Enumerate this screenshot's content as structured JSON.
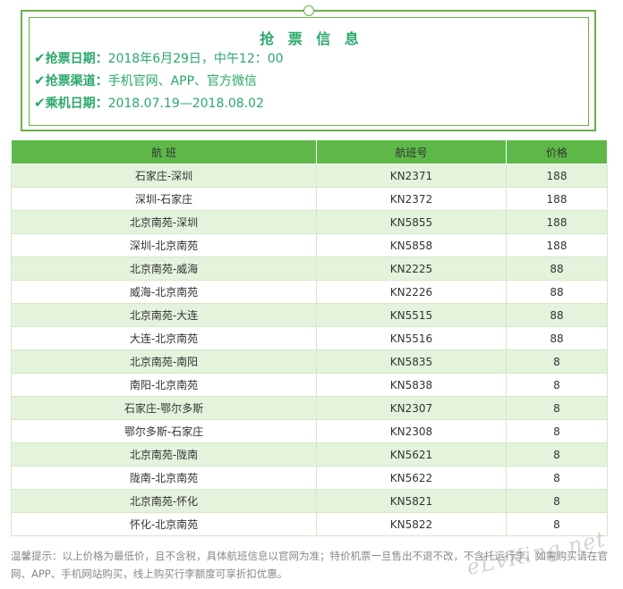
{
  "info": {
    "title": "抢 票 信 息",
    "check_glyph": "✔",
    "lines": [
      {
        "label": "抢票日期：",
        "value": "2018年6月29日，中午12：00"
      },
      {
        "label": "抢票渠道：",
        "value": "手机官网、APP、官方微信"
      },
      {
        "label": "乘机日期：",
        "value": "2018.07.19—2018.08.02"
      }
    ]
  },
  "table": {
    "headers": [
      "航 班",
      "航班号",
      "价格"
    ],
    "rows": [
      [
        "石家庄-深圳",
        "KN2371",
        "188"
      ],
      [
        "深圳-石家庄",
        "KN2372",
        "188"
      ],
      [
        "北京南苑-深圳",
        "KN5855",
        "188"
      ],
      [
        "深圳-北京南苑",
        "KN5858",
        "188"
      ],
      [
        "北京南苑-威海",
        "KN2225",
        "88"
      ],
      [
        "威海-北京南苑",
        "KN2226",
        "88"
      ],
      [
        "北京南苑-大连",
        "KN5515",
        "88"
      ],
      [
        "大连-北京南苑",
        "KN5516",
        "88"
      ],
      [
        "北京南苑-南阳",
        "KN5835",
        "8"
      ],
      [
        "南阳-北京南苑",
        "KN5838",
        "8"
      ],
      [
        "石家庄-鄂尔多斯",
        "KN2307",
        "8"
      ],
      [
        "鄂尔多斯-石家庄",
        "KN2308",
        "8"
      ],
      [
        "北京南苑-陇南",
        "KN5621",
        "8"
      ],
      [
        "陇南-北京南苑",
        "KN5622",
        "8"
      ],
      [
        "北京南苑-怀化",
        "KN5821",
        "8"
      ],
      [
        "怀化-北京南苑",
        "KN5822",
        "8"
      ]
    ]
  },
  "notice": "温馨提示：以上价格为最低价，且不含税，具体航班信息以官网为准；特价机票一旦售出不退不改，不含托运行李。如需购买请在官网、APP、手机网站购买，线上购买行李额度可享折扣优惠。",
  "watermark": "eLvKing.net",
  "colors": {
    "accent_green": "#5db848",
    "title_green": "#2aa86a",
    "row_tint": "#e4f3dc"
  }
}
